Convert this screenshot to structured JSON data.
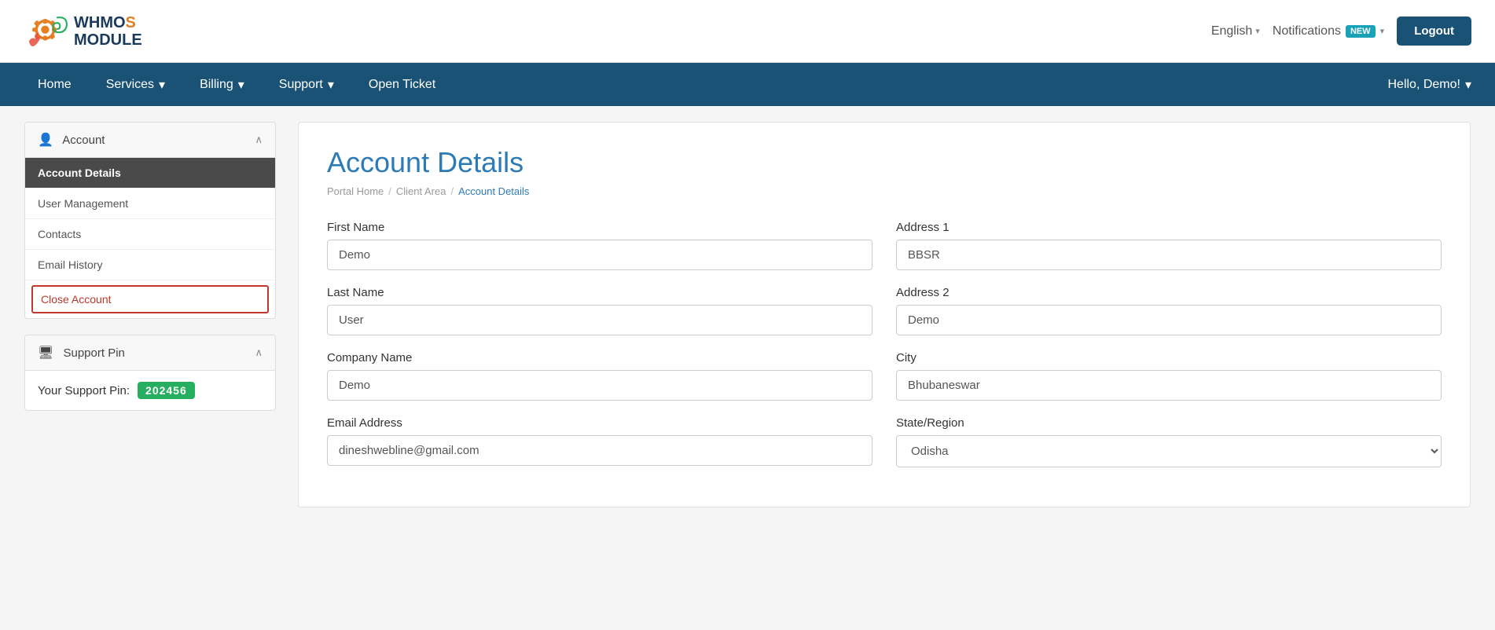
{
  "header": {
    "logo_text": "WHMCS MODULE",
    "lang_label": "English",
    "notif_label": "Notifications",
    "notif_badge": "NEW",
    "logout_label": "Logout"
  },
  "nav": {
    "items": [
      {
        "label": "Home",
        "has_dropdown": false
      },
      {
        "label": "Services",
        "has_dropdown": true
      },
      {
        "label": "Billing",
        "has_dropdown": true
      },
      {
        "label": "Support",
        "has_dropdown": true
      },
      {
        "label": "Open Ticket",
        "has_dropdown": false
      }
    ],
    "user_greeting": "Hello, Demo!"
  },
  "sidebar": {
    "account_section_title": "Account",
    "items": [
      {
        "label": "Account Details",
        "active": true
      },
      {
        "label": "User Management",
        "active": false
      },
      {
        "label": "Contacts",
        "active": false
      },
      {
        "label": "Email History",
        "active": false
      },
      {
        "label": "Close Account",
        "close": true
      }
    ],
    "support_pin_section_title": "Support Pin",
    "support_pin_label": "Your Support Pin:",
    "support_pin_value": "202456"
  },
  "content": {
    "page_title": "Account Details",
    "breadcrumb": {
      "portal_home": "Portal Home",
      "client_area": "Client Area",
      "current": "Account Details"
    },
    "form": {
      "first_name_label": "First Name",
      "first_name_value": "Demo",
      "last_name_label": "Last Name",
      "last_name_value": "User",
      "company_name_label": "Company Name",
      "company_name_value": "Demo",
      "email_label": "Email Address",
      "email_value": "dineshwebline@gmail.com",
      "address1_label": "Address 1",
      "address1_value": "BBSR",
      "address2_label": "Address 2",
      "address2_value": "Demo",
      "city_label": "City",
      "city_value": "Bhubaneswar",
      "state_label": "State/Region",
      "state_value": "Odisha"
    }
  }
}
